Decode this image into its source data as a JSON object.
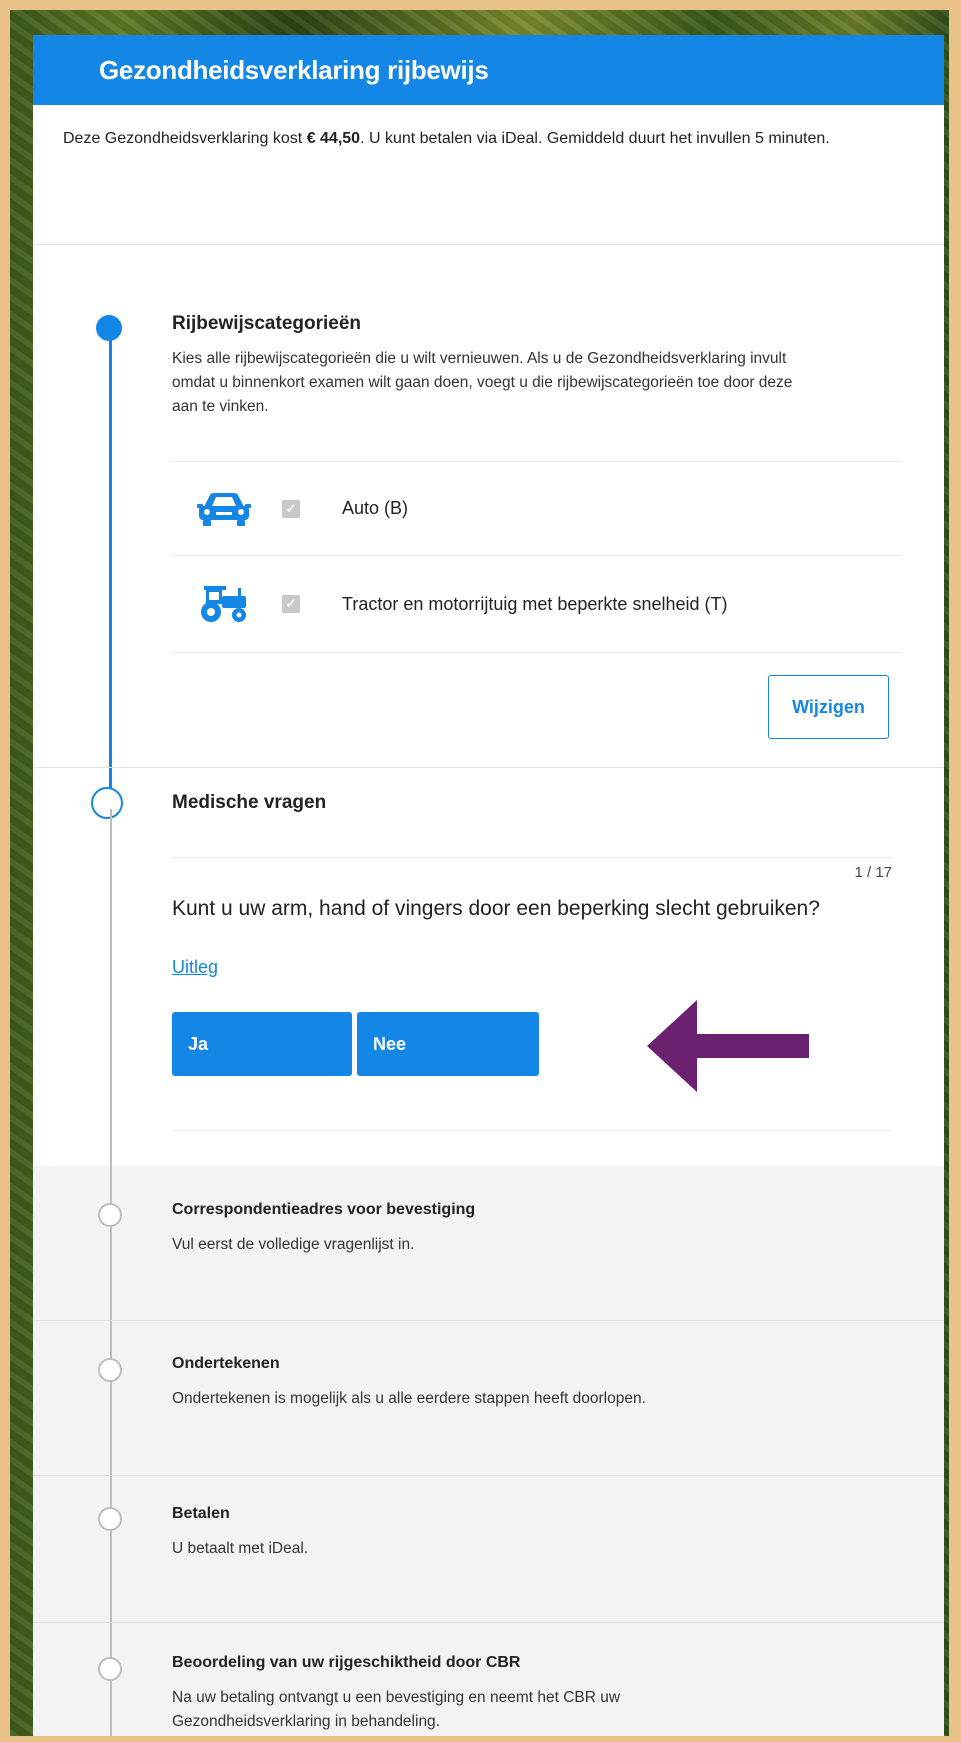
{
  "header": {
    "title": "Gezondheidsverklaring rijbewijs"
  },
  "intro": {
    "text_before": "Deze Gezondheidsverklaring kost ",
    "price": "€ 44,50",
    "text_after": ". U kunt betalen via iDeal. Gemiddeld duurt het invullen 5 minuten."
  },
  "categories_step": {
    "title": "Rijbewijscategorieën",
    "description": "Kies alle rijbewijscategorieën die u wilt vernieuwen. Als u de Gezondheidsverklaring invult omdat u binnenkort examen wilt gaan doen, voegt u die rijbewijscategorieën toe door deze aan te vinken.",
    "items": [
      {
        "icon": "car-icon",
        "label": "Auto (B)",
        "checked": true
      },
      {
        "icon": "tractor-icon",
        "label": "Tractor en motorrijtuig met beperkte snelheid (T)",
        "checked": true
      }
    ],
    "change_button": "Wijzigen"
  },
  "medical_step": {
    "title": "Medische vragen",
    "counter": "1 / 17",
    "question": "Kunt u uw arm, hand of vingers door een beperking slecht gebruiken?",
    "explain_link": "Uitleg",
    "yes_button": "Ja",
    "no_button": "Nee"
  },
  "pending_steps": [
    {
      "title": "Correspondentieadres voor bevestiging",
      "description": "Vul eerst de volledige vragenlijst in."
    },
    {
      "title": "Ondertekenen",
      "description": "Ondertekenen is mogelijk als u alle eerdere stappen heeft doorlopen."
    },
    {
      "title": "Betalen",
      "description": "U betaalt met iDeal."
    },
    {
      "title": "Beoordeling van uw rijgeschiktheid door CBR",
      "description": "Na uw betaling ontvangt u een bevestiging en neemt het CBR uw Gezondheidsverklaring in behandeling."
    }
  ],
  "colors": {
    "primary": "#1486e6",
    "annotation_arrow": "#6b2170",
    "frame": "#e8c287"
  }
}
